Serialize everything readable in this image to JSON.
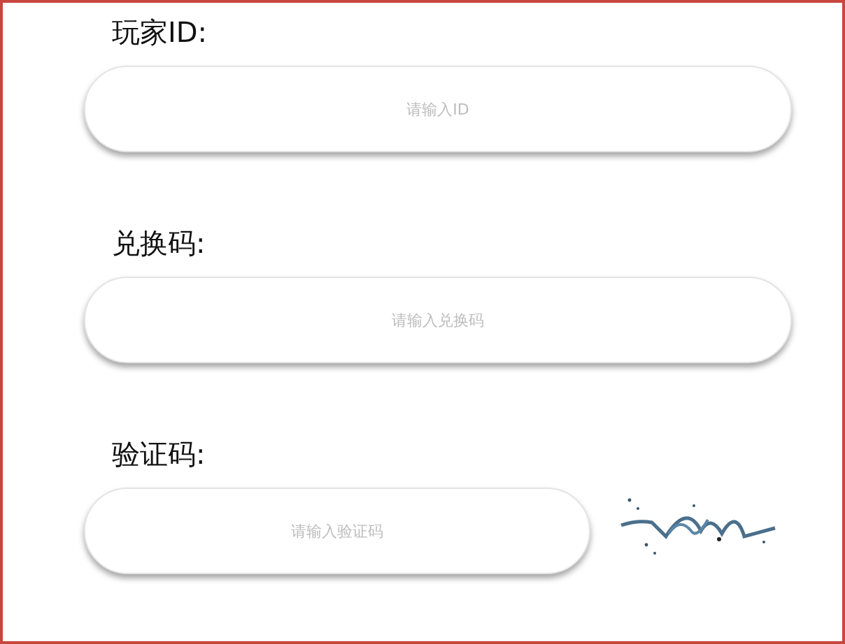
{
  "fields": [
    {
      "label": "玩家ID:",
      "placeholder": "请输入ID",
      "kind": "text"
    },
    {
      "label": "兑换码:",
      "placeholder": "请输入兑换码",
      "kind": "text"
    },
    {
      "label": "验证码:",
      "placeholder": "请输入验证码",
      "kind": "captcha"
    }
  ]
}
